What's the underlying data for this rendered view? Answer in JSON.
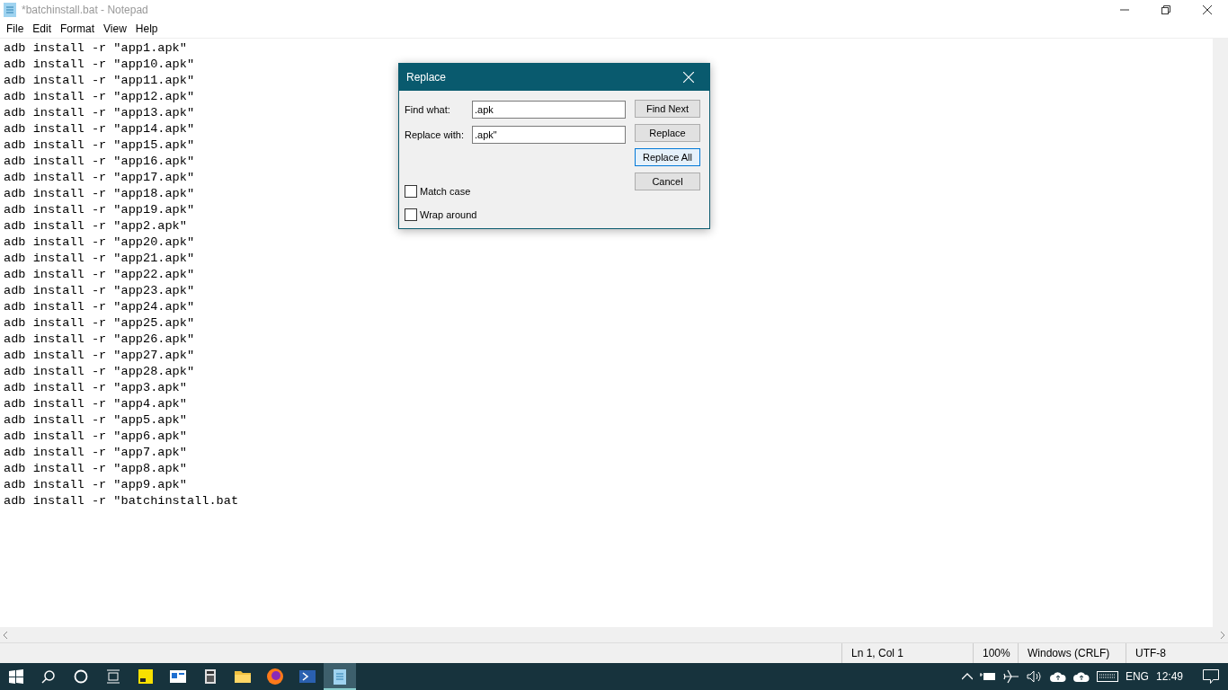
{
  "window": {
    "title": "*batchinstall.bat - Notepad"
  },
  "menu": [
    "File",
    "Edit",
    "Format",
    "View",
    "Help"
  ],
  "editor": {
    "lines": [
      "adb install -r \"app1.apk\"",
      "adb install -r \"app10.apk\"",
      "adb install -r \"app11.apk\"",
      "adb install -r \"app12.apk\"",
      "adb install -r \"app13.apk\"",
      "adb install -r \"app14.apk\"",
      "adb install -r \"app15.apk\"",
      "adb install -r \"app16.apk\"",
      "adb install -r \"app17.apk\"",
      "adb install -r \"app18.apk\"",
      "adb install -r \"app19.apk\"",
      "adb install -r \"app2.apk\"",
      "adb install -r \"app20.apk\"",
      "adb install -r \"app21.apk\"",
      "adb install -r \"app22.apk\"",
      "adb install -r \"app23.apk\"",
      "adb install -r \"app24.apk\"",
      "adb install -r \"app25.apk\"",
      "adb install -r \"app26.apk\"",
      "adb install -r \"app27.apk\"",
      "adb install -r \"app28.apk\"",
      "adb install -r \"app3.apk\"",
      "adb install -r \"app4.apk\"",
      "adb install -r \"app5.apk\"",
      "adb install -r \"app6.apk\"",
      "adb install -r \"app7.apk\"",
      "adb install -r \"app8.apk\"",
      "adb install -r \"app9.apk\"",
      "adb install -r \"batchinstall.bat"
    ]
  },
  "dialog": {
    "title": "Replace",
    "fields": [
      {
        "label": "Find what:",
        "value": ".apk"
      },
      {
        "label": "Replace with:",
        "value": ".apk\""
      }
    ],
    "buttons": [
      {
        "label": "Find Next",
        "selected": false
      },
      {
        "label": "Replace",
        "selected": false
      },
      {
        "label": "Replace All",
        "selected": true
      },
      {
        "label": "Cancel",
        "selected": false
      }
    ],
    "checkboxes": [
      {
        "label": "Match case",
        "checked": false
      },
      {
        "label": "Wrap around",
        "checked": false
      }
    ]
  },
  "status_bar": [
    "Ln 1, Col 1",
    "100%",
    "Windows (CRLF)",
    "UTF-8"
  ],
  "taskbar": {
    "apps": [
      {
        "kind": "sticky",
        "selected": false
      },
      {
        "kind": "news",
        "selected": false
      },
      {
        "kind": "calculator",
        "selected": false
      },
      {
        "kind": "folder",
        "selected": false
      },
      {
        "kind": "firefox",
        "selected": false
      },
      {
        "kind": "powershell",
        "selected": false
      },
      {
        "kind": "notepad",
        "selected": true
      }
    ],
    "language": "ENG",
    "time": "12:49"
  }
}
